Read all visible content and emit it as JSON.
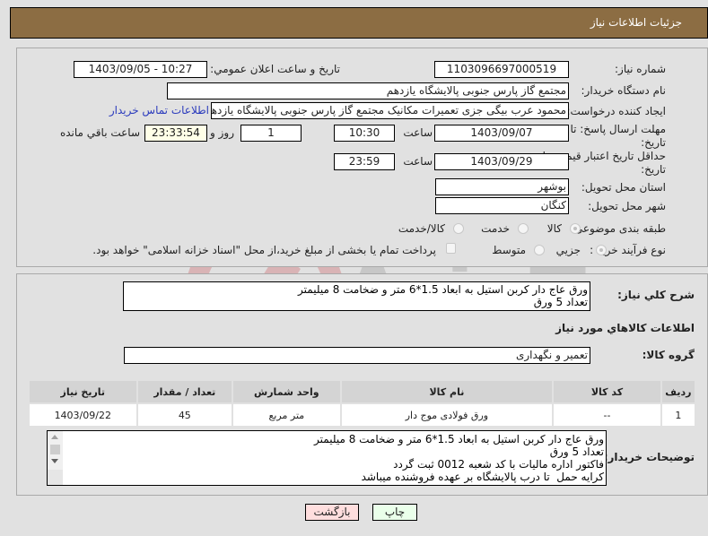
{
  "header": {
    "title": "جزئیات اطلاعات نیاز"
  },
  "form": {
    "need_number": {
      "label": "شماره نیاز:",
      "value": "1103096697000519"
    },
    "announce_datetime": {
      "label": "تاریخ و ساعت اعلان عمومي:",
      "value": "1403/09/05 - 10:27"
    },
    "buyer_org": {
      "label": "نام دستگاه خریدار:",
      "value": "مجتمع گاز پارس جنوبی  پالایشگاه یازدهم"
    },
    "requester": {
      "label": "ایجاد کننده درخواست:",
      "value": "محمود عرب بیگی جزی تعمیرات مکانیک مجتمع گاز پارس جنوبی  پالایشگاه یازدهم",
      "contact_link": "اطلاعات تماس خریدار"
    },
    "reply_deadline": {
      "label": "مهلت ارسال پاسخ: تا تاریخ:",
      "date": "1403/09/07",
      "time_label": "ساعت",
      "time": "10:30",
      "days": "1",
      "days_label": "روز و",
      "remaining": "23:33:54",
      "remaining_label": "ساعت باقي مانده"
    },
    "price_validity": {
      "label": "حداقل تاریخ اعتبار قیمت: تا تاریخ:",
      "date": "1403/09/29",
      "time_label": "ساعت",
      "time": "23:59"
    },
    "province": {
      "label": "استان محل تحویل:",
      "value": "بوشهر"
    },
    "city": {
      "label": "شهر محل تحویل:",
      "value": "کنگان"
    },
    "category": {
      "label": "طبقه بندی موضوعی:",
      "options": [
        "کالا",
        "خدمت",
        "کالا/خدمت"
      ],
      "selected": "کالا"
    },
    "purchase_type": {
      "label": "نوع فرآیند خرید :",
      "options": [
        "جزیي",
        "متوسط"
      ],
      "selected": "جزیي",
      "treasury_note": "پرداخت تمام یا بخشی از مبلغ خرید،از محل \"اسناد خزانه اسلامی\" خواهد بود.",
      "treasury_checked": false
    }
  },
  "description": {
    "label": "شرح کلي نیاز:",
    "text": "ورق عاج دار کربن استیل به ابعاد 1.5*6 متر و ضخامت 8 میلیمتر\nتعداد 5 ورق"
  },
  "goods_section": {
    "title": "اطلاعات کالاهاي مورد نیاز",
    "group_label": "گروه کالا:",
    "group_value": "تعمیر و نگهداری",
    "table": {
      "headers": [
        "ردیف",
        "کد کالا",
        "نام کالا",
        "واحد شمارش",
        "تعداد / مقدار",
        "تاریخ نیاز"
      ],
      "rows": [
        [
          "1",
          "--",
          "ورق فولادی موج دار",
          "متر مربع",
          "45",
          "1403/09/22"
        ]
      ]
    }
  },
  "buyer_notes": {
    "label": "توضیحات خریدار:",
    "text": "ورق عاج دار کربن استیل به ابعاد 1.5*6 متر و ضخامت 8 میلیمتر\nتعداد 5 ورق\nفاکتور اداره مالیات با کد شعبه 0012 ثبت گردد\nکرایه حمل  تا درب پالایشگاه بر عهده فروشنده میباشد"
  },
  "buttons": {
    "print": "چاپ",
    "back": "بازگشت"
  },
  "colors": {
    "header_bg": "#8c6d43",
    "link": "#2b3bbd",
    "print_bg": "#eaffea",
    "back_bg": "#ffdede"
  }
}
